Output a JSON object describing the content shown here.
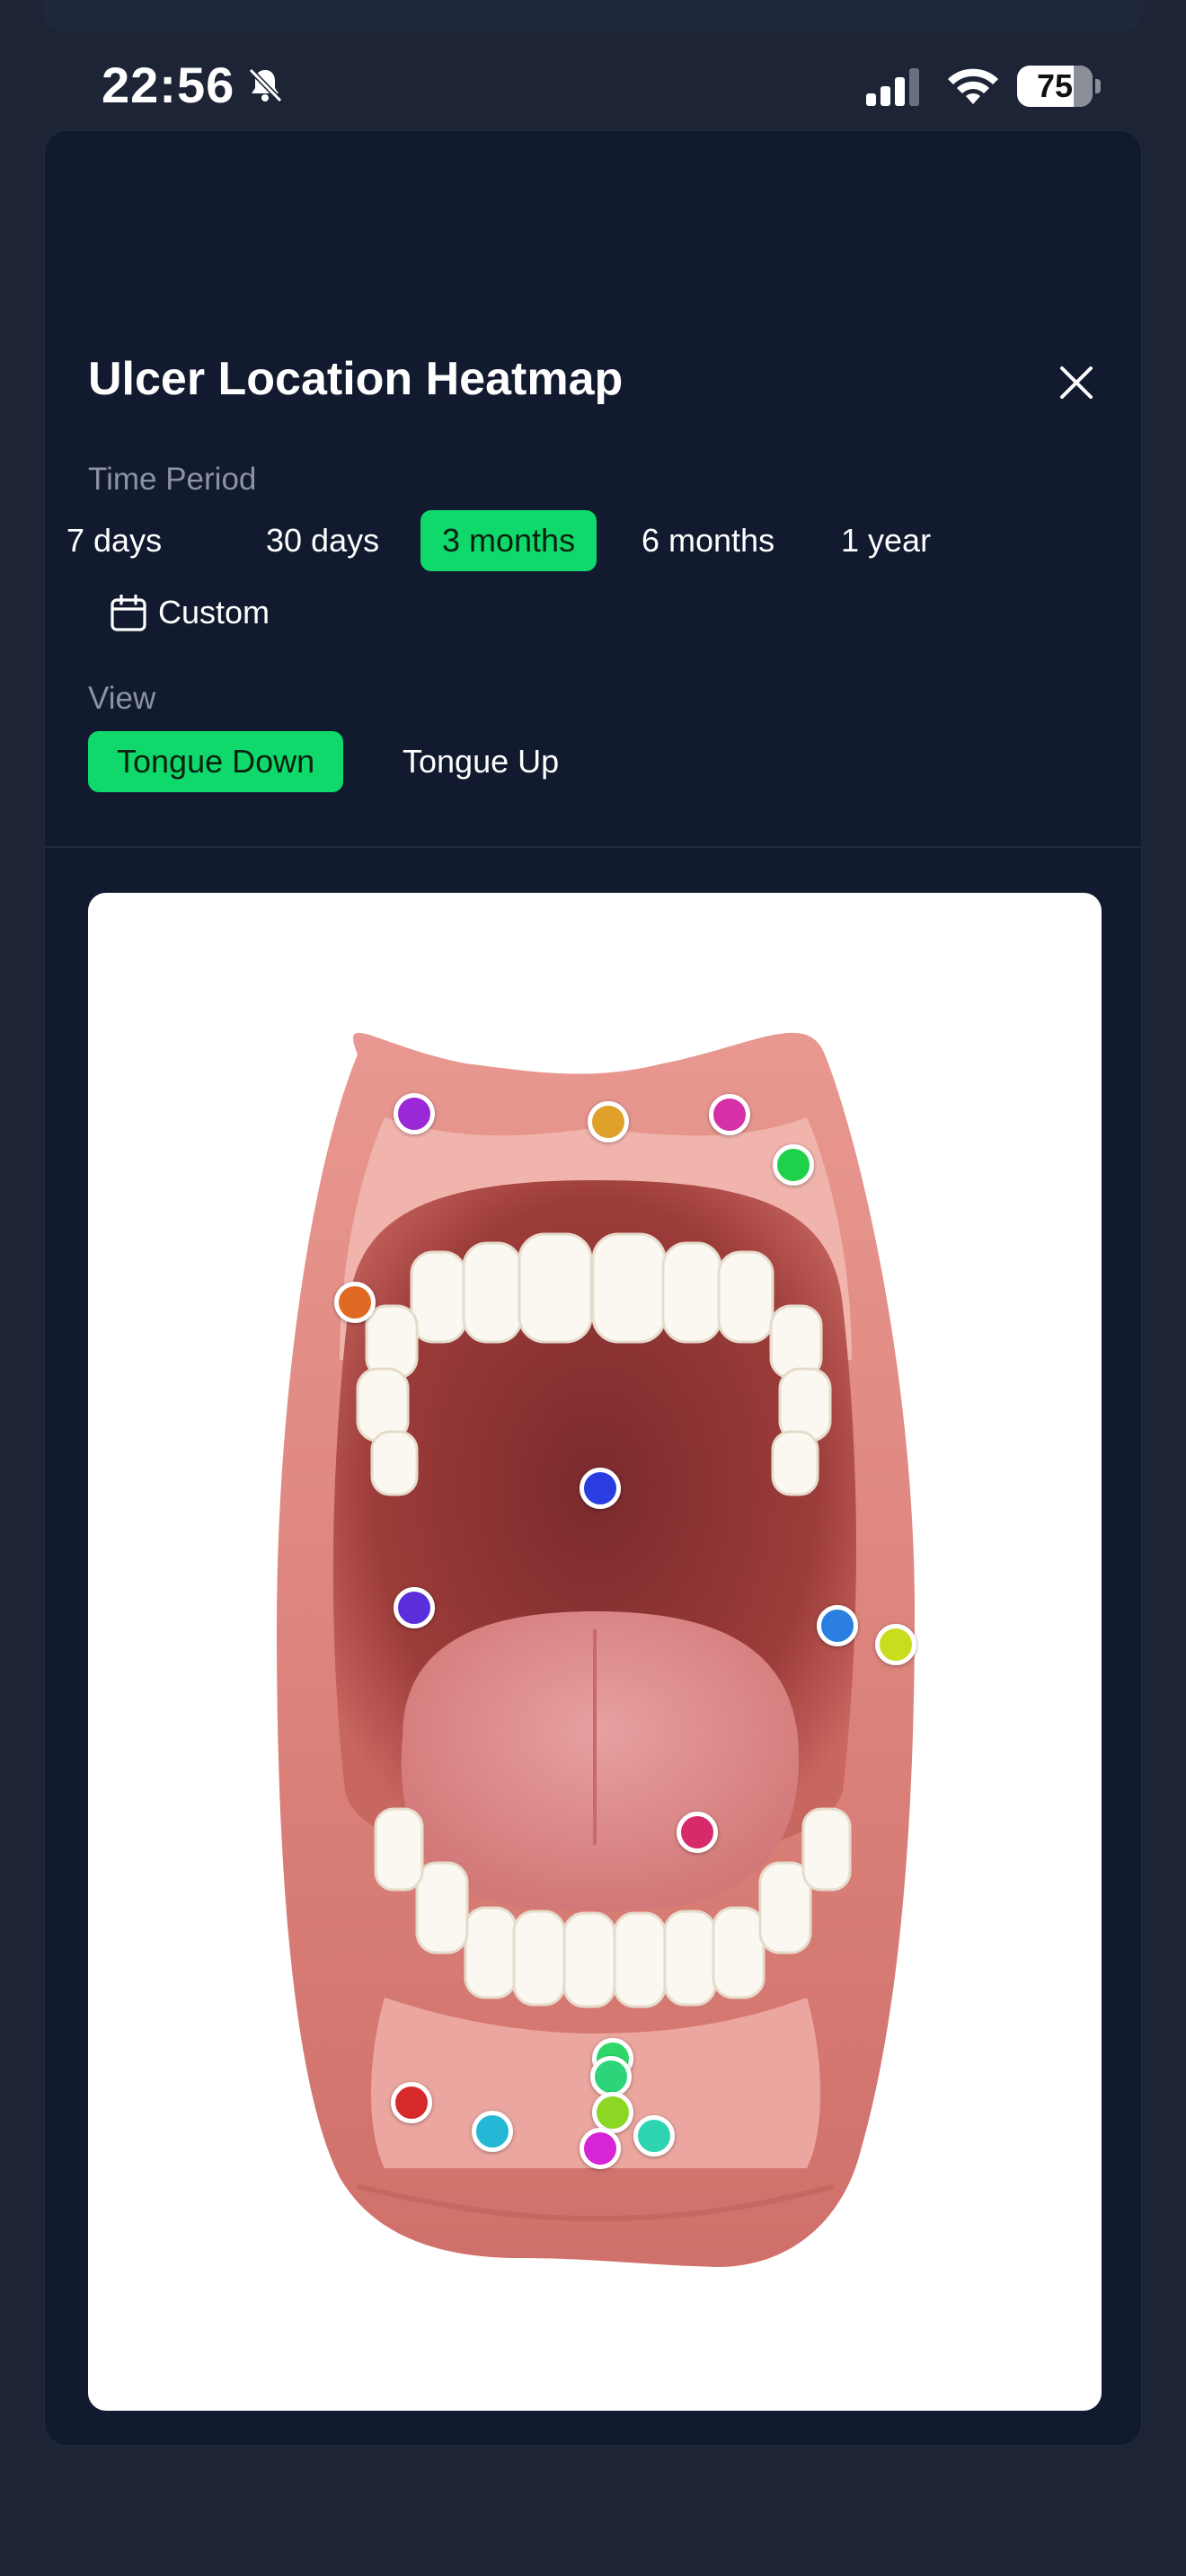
{
  "status_bar": {
    "time": "22:56",
    "battery_level": "75",
    "battery_fraction": 0.75,
    "icons": [
      "bell-slash-icon",
      "cellular-signal-icon",
      "wifi-icon",
      "battery-icon"
    ]
  },
  "modal": {
    "title": "Ulcer Location Heatmap",
    "close_icon": "close-icon",
    "time_period": {
      "label": "Time Period",
      "options": [
        "7 days",
        "30 days",
        "3 months",
        "6 months",
        "1 year"
      ],
      "selected": "3 months",
      "custom_label": "Custom",
      "custom_icon": "calendar-icon"
    },
    "view": {
      "label": "View",
      "options": [
        "Tongue Down",
        "Tongue Up"
      ],
      "selected": "Tongue Down"
    }
  },
  "colors": {
    "accent": "#10d96c",
    "background": "#1c2436",
    "modal_background": "#111a2e",
    "muted_text": "#8c93a3"
  },
  "ulcer_markers": [
    {
      "color": "#9b28d6"
    },
    {
      "color": "#e0a12b"
    },
    {
      "color": "#d630a8"
    },
    {
      "color": "#1fd14a"
    },
    {
      "color": "#e06a24"
    },
    {
      "color": "#2a3de0"
    },
    {
      "color": "#5a2ed8"
    },
    {
      "color": "#2a7fe0"
    },
    {
      "color": "#c8dd1e"
    },
    {
      "color": "#d62a6a"
    },
    {
      "color": "#2fd86a"
    },
    {
      "color": "#2ed47a"
    },
    {
      "color": "#8cd624"
    },
    {
      "color": "#d62a2a"
    },
    {
      "color": "#24b8d6"
    },
    {
      "color": "#d624d6"
    },
    {
      "color": "#2ed4b2"
    }
  ]
}
